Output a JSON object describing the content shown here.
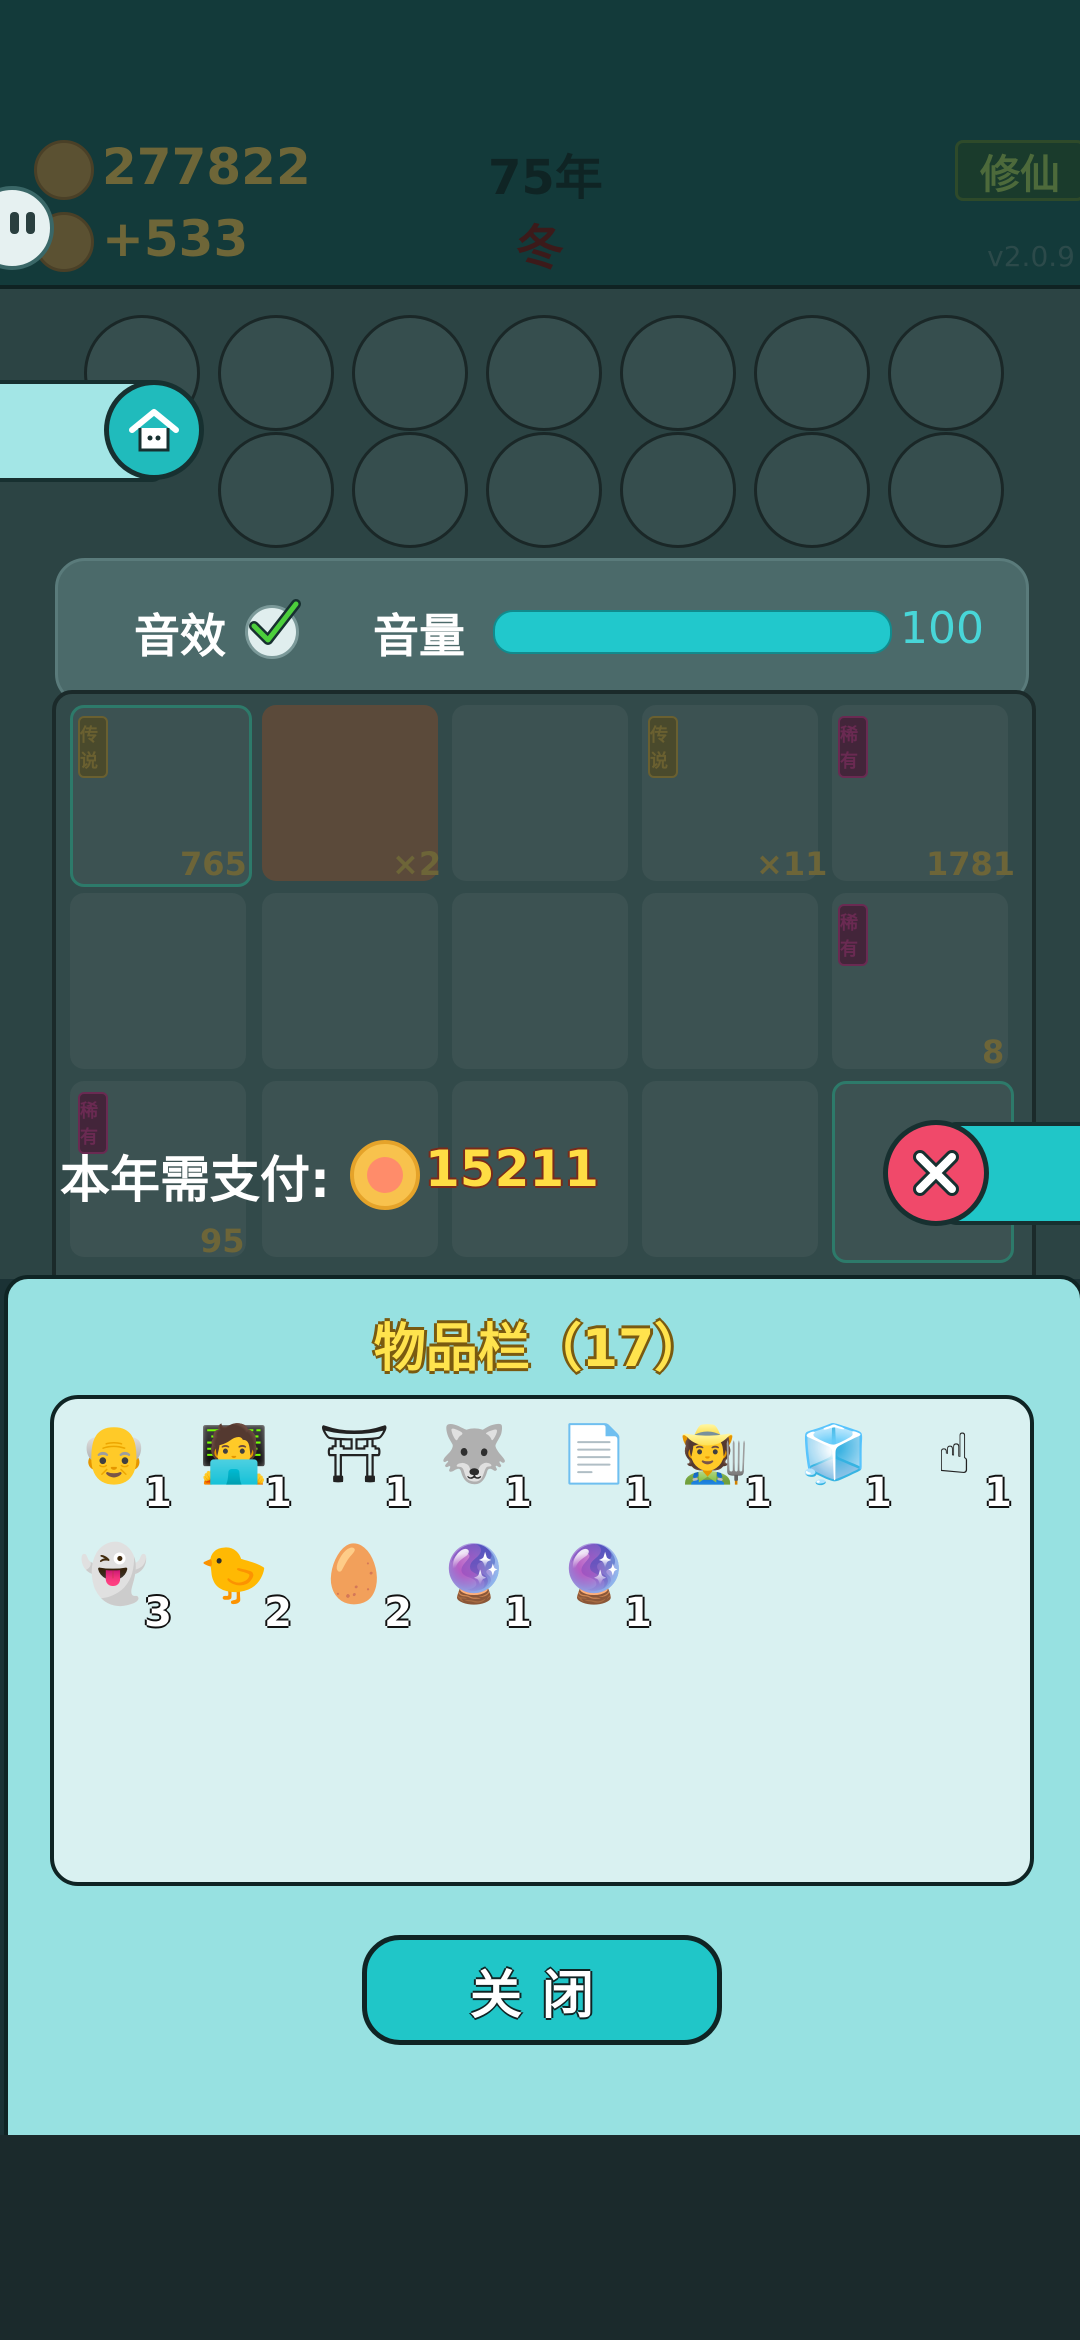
{
  "hud": {
    "coins": "277822",
    "income": "+533",
    "year": "75年",
    "season": "冬",
    "xiu_label": "修仙",
    "version": "v2.0.9"
  },
  "sound": {
    "effect_label": "音效",
    "effect_enabled": true,
    "volume_label": "音量",
    "volume_value": "100",
    "volume_percent": 100
  },
  "grid": {
    "cells": [
      {
        "count": "765",
        "tag": "传说"
      },
      {
        "count": "×2",
        "tag": ""
      },
      {
        "count": "",
        "tag": ""
      },
      {
        "count": "×11",
        "tag": "传说"
      },
      {
        "count": "1781",
        "tag": "稀有"
      },
      {
        "count": "8",
        "tag": "稀有"
      },
      {
        "count": "95",
        "tag": "稀有"
      }
    ]
  },
  "payment": {
    "label": "本年需支付:",
    "amount": "15211"
  },
  "inventory": {
    "title": "物品栏（17）",
    "items": [
      {
        "icon": "old-man-glasses-icon",
        "glyph": "👴",
        "count": "1"
      },
      {
        "icon": "programmer-laptop-icon",
        "glyph": "🧑‍💻",
        "count": "1"
      },
      {
        "icon": "torii-house-icon",
        "glyph": "⛩",
        "count": "1"
      },
      {
        "icon": "husky-crown-icon",
        "glyph": "🐺",
        "count": "1"
      },
      {
        "icon": "copy-paste-card-icon",
        "glyph": "📄",
        "count": "1"
      },
      {
        "icon": "farmer-hat-icon",
        "glyph": "🧑‍🌾",
        "count": "1"
      },
      {
        "icon": "fridge-icon",
        "glyph": "🧊",
        "count": "1"
      },
      {
        "icon": "pointing-hand-icon",
        "glyph": "☝",
        "count": "1"
      },
      {
        "icon": "ghost-icon",
        "glyph": "👻",
        "count": "3"
      },
      {
        "icon": "chick-icon",
        "glyph": "🐤",
        "count": "2"
      },
      {
        "icon": "egg-icon",
        "glyph": "🥚",
        "count": "2"
      },
      {
        "icon": "magenta-gacha-ball-icon",
        "glyph": "🔮",
        "count": "1"
      },
      {
        "icon": "yellow-gacha-ball-icon",
        "glyph": "🔮",
        "count": "1"
      }
    ],
    "close_label": "关闭"
  }
}
